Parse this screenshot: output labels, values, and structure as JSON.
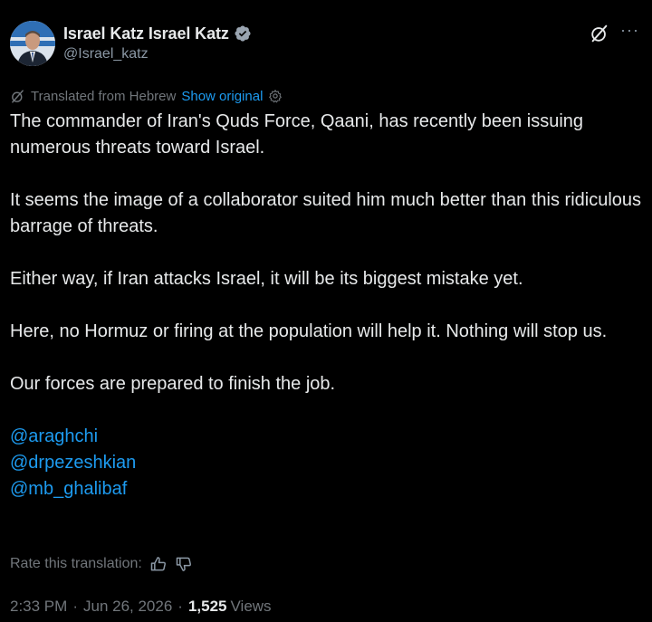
{
  "author": {
    "display_name": "Israel Katz Israel Katz",
    "handle": "@Israel_katz"
  },
  "translation": {
    "notice": "Translated from Hebrew",
    "show_original_label": "Show original"
  },
  "tweet": {
    "paragraphs": [
      "The commander of Iran's Quds Force, Qaani, has recently been issuing numerous threats toward Israel.",
      "It seems the image of a collaborator suited him much better than this ridiculous barrage of threats.",
      "Either way, if Iran attacks Israel, it will be its biggest mistake yet.",
      "Here, no Hormuz or firing at the population will help it. Nothing will stop us.",
      "Our forces are prepared to finish the job."
    ],
    "mentions": [
      "@araghchi",
      "@drpezeshkian",
      "@mb_ghalibaf"
    ]
  },
  "rate": {
    "label": "Rate this translation:"
  },
  "meta": {
    "time": "2:33 PM",
    "date": "Jun 26, 2026",
    "separator": "·",
    "views_count": "1,525",
    "views_label": "Views"
  },
  "colors": {
    "background": "#000000",
    "text": "#e7e9ea",
    "muted": "#71767b",
    "link": "#1d9bf0",
    "verified": "#9aa5b1"
  },
  "icons": {
    "verified": "verified-badge-icon",
    "grok": "grok-icon",
    "more": "more-horizontal-icon",
    "translate": "translate-icon",
    "settings": "gear-icon",
    "thumbs_up": "thumbs-up-icon",
    "thumbs_down": "thumbs-down-icon"
  }
}
